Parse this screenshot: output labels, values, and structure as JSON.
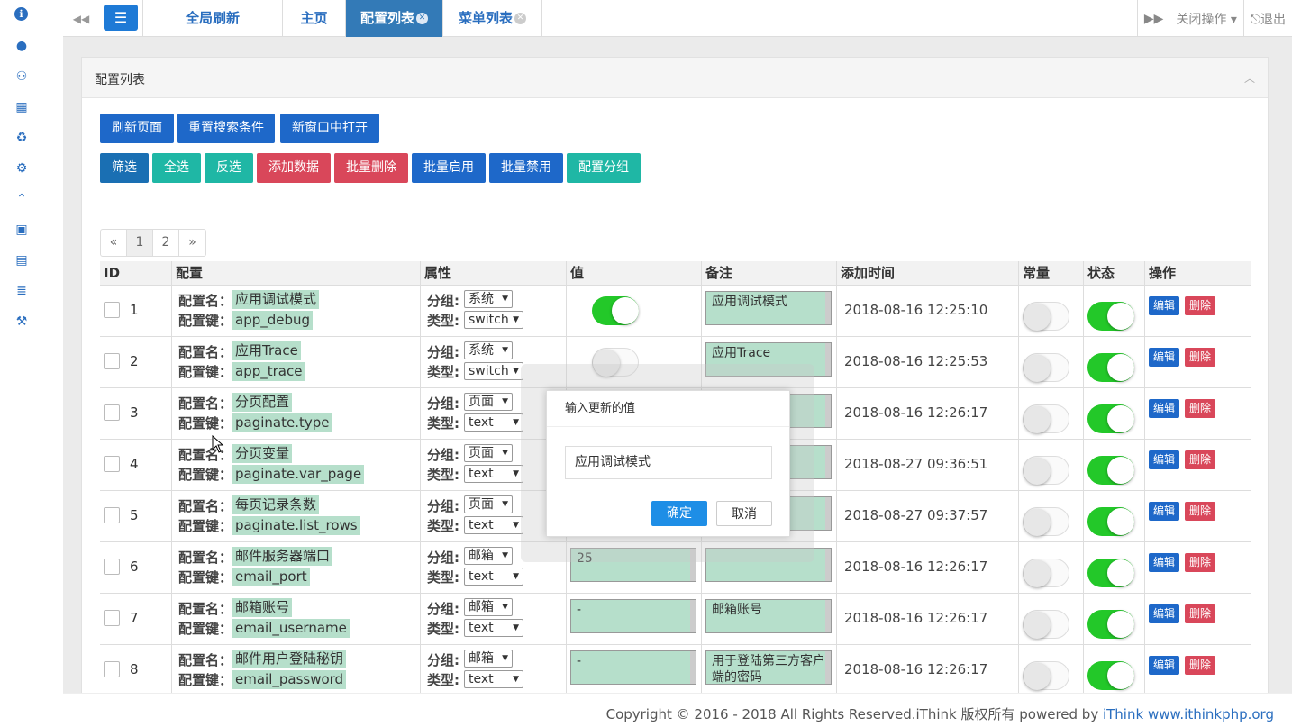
{
  "sidebar": {
    "icons": [
      "info-icon",
      "user-icon",
      "users-icon",
      "dashboard-icon",
      "recycle-icon",
      "gears-icon",
      "chevron-up-circle-icon",
      "briefcase-icon",
      "document-icon",
      "database-icon",
      "gavel-icon"
    ]
  },
  "topbar": {
    "tabs": [
      {
        "label": "全局刷新",
        "active": false,
        "closable": false
      },
      {
        "label": "主页",
        "active": false,
        "closable": false
      },
      {
        "label": "配置列表",
        "active": true,
        "closable": true
      },
      {
        "label": "菜单列表",
        "active": false,
        "closable": true
      }
    ],
    "close_ops": "关闭操作",
    "logout": "退出"
  },
  "panel": {
    "title": "配置列表"
  },
  "toolbar1": [
    "刷新页面",
    "重置搜索条件",
    "新窗口中打开"
  ],
  "toolbar2": [
    "筛选",
    "全选",
    "反选",
    "添加数据",
    "批量删除",
    "批量启用",
    "批量禁用",
    "配置分组"
  ],
  "pager": [
    "«",
    "1",
    "2",
    "»"
  ],
  "table": {
    "headers": [
      "ID",
      "配置",
      "属性",
      "值",
      "备注",
      "添加时间",
      "常量",
      "状态",
      "操作"
    ],
    "name_label": "配置名：",
    "key_label": "配置键：",
    "group_label": "分组:",
    "type_label": "类型:",
    "edit": "编辑",
    "delete": "删除",
    "rows": [
      {
        "id": "1",
        "name": "应用调试模式",
        "key": "app_debug",
        "group": "系统",
        "type": "switch",
        "value": "",
        "value_switch": true,
        "remark": "应用调试模式",
        "time": "2018-08-16 12:25:10",
        "const": false,
        "status": true
      },
      {
        "id": "2",
        "name": "应用Trace",
        "key": "app_trace",
        "group": "系统",
        "type": "switch",
        "value": "",
        "value_switch": false,
        "remark": "应用Trace",
        "time": "2018-08-16 12:25:53",
        "const": false,
        "status": true
      },
      {
        "id": "3",
        "name": "分页配置",
        "key": "paginate.type",
        "group": "页面",
        "type": "text",
        "value": "",
        "remark": "",
        "time": "2018-08-16 12:26:17",
        "const": false,
        "status": true
      },
      {
        "id": "4",
        "name": "分页变量",
        "key": "paginate.var_page",
        "group": "页面",
        "type": "text",
        "value": "",
        "remark": "",
        "time": "2018-08-27 09:36:51",
        "const": false,
        "status": true
      },
      {
        "id": "5",
        "name": "每页记录条数",
        "key": "paginate.list_rows",
        "group": "页面",
        "type": "text",
        "value": "",
        "remark": "",
        "time": "2018-08-27 09:37:57",
        "const": false,
        "status": true
      },
      {
        "id": "6",
        "name": "邮件服务器端口",
        "key": "email_port",
        "group": "邮箱",
        "type": "text",
        "value": "25",
        "remark": "",
        "time": "2018-08-16 12:26:17",
        "const": false,
        "status": true
      },
      {
        "id": "7",
        "name": "邮箱账号",
        "key": "email_username",
        "group": "邮箱",
        "type": "text",
        "value": "-",
        "remark": "邮箱账号",
        "time": "2018-08-16 12:26:17",
        "const": false,
        "status": true
      },
      {
        "id": "8",
        "name": "邮件用户登陆秘钥",
        "key": "email_password",
        "group": "邮箱",
        "type": "text",
        "value": "-",
        "remark": "用于登陆第三方客户端的密码",
        "time": "2018-08-16 12:26:17",
        "const": false,
        "status": true
      }
    ]
  },
  "modal": {
    "title": "输入更新的值",
    "input_value": "应用调试模式",
    "confirm": "确定",
    "cancel": "取消"
  },
  "footer": {
    "text": "Copyright © 2016 - 2018 All Rights Reserved.iThink 版权所有 powered by ",
    "link1": "iThink",
    "link2": "www.ithinkphp.org"
  },
  "colors": {
    "primary": "#1e68c9",
    "teal": "#1fb7a5",
    "danger": "#d9475a",
    "switch_on": "#23c829",
    "highlight": "#b6dfcb"
  }
}
